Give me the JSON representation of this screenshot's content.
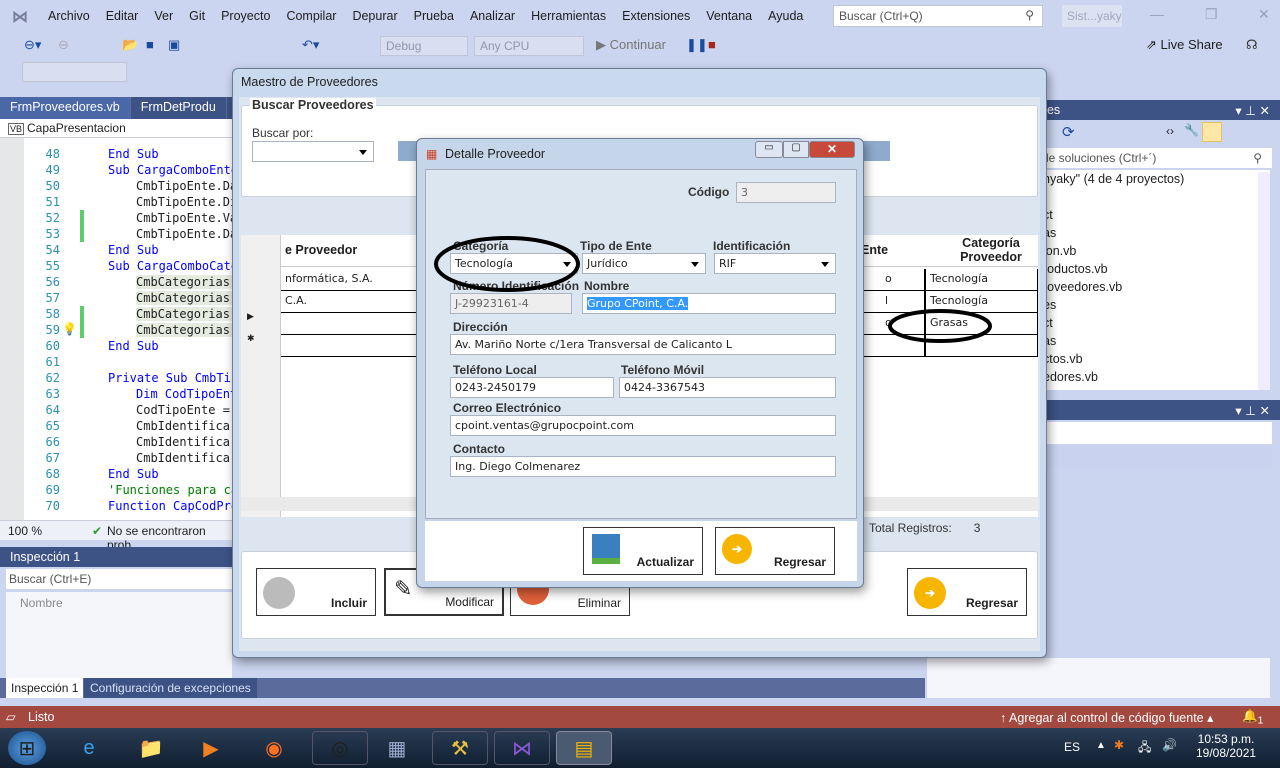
{
  "menu": [
    "Archivo",
    "Editar",
    "Ver",
    "Git",
    "Proyecto",
    "Compilar",
    "Depurar",
    "Prueba",
    "Analizar",
    "Herramientas",
    "Extensiones",
    "Ventana",
    "Ayuda"
  ],
  "search_placeholder": "Buscar (Ctrl+Q)",
  "solution_short": "Sist...yaky",
  "toolbar": {
    "config": "Debug",
    "platform": "Any CPU",
    "continue": "Continuar",
    "live_share": "Live Share"
  },
  "editor": {
    "tabs": [
      "FrmProveedores.vb",
      "FrmDetProdu"
    ],
    "project": "CapaPresentacion",
    "zoom": "100 %",
    "status": "No se encontraron prob",
    "lines": [
      {
        "n": "48",
        "t": "End Sub",
        "c": "kw",
        "i": 0
      },
      {
        "n": "49",
        "t": "Sub CargaComboEnte",
        "c": "kw",
        "i": 0
      },
      {
        "n": "50",
        "t": "CmbTipoEnte.Da",
        "c": "",
        "i": 1
      },
      {
        "n": "51",
        "t": "CmbTipoEnte.Di",
        "c": "",
        "i": 1
      },
      {
        "n": "52",
        "t": "CmbTipoEnte.Va",
        "c": "",
        "i": 1
      },
      {
        "n": "53",
        "t": "CmbTipoEnte.Da",
        "c": "",
        "i": 1
      },
      {
        "n": "54",
        "t": "End Sub",
        "c": "kw",
        "i": 0
      },
      {
        "n": "55",
        "t": "Sub CargaComboCate",
        "c": "kw",
        "i": 0
      },
      {
        "n": "56",
        "t": "CmbCategorias.",
        "c": "hl",
        "i": 1
      },
      {
        "n": "57",
        "t": "CmbCategorias.",
        "c": "hl",
        "i": 1
      },
      {
        "n": "58",
        "t": "CmbCategorias.",
        "c": "hl",
        "i": 1
      },
      {
        "n": "59",
        "t": "CmbCategorias.",
        "c": "hl",
        "i": 1
      },
      {
        "n": "60",
        "t": "End Sub",
        "c": "kw",
        "i": 0
      },
      {
        "n": "61",
        "t": "",
        "c": "",
        "i": 0
      },
      {
        "n": "62",
        "t": "Private Sub CmbTip",
        "c": "kw",
        "i": 0
      },
      {
        "n": "63",
        "t": "Dim CodTipoEnt",
        "c": "kw",
        "i": 1
      },
      {
        "n": "64",
        "t": "CodTipoEnte =",
        "c": "",
        "i": 1
      },
      {
        "n": "65",
        "t": "CmbIdentifica.",
        "c": "",
        "i": 1
      },
      {
        "n": "66",
        "t": "CmbIdentifica.",
        "c": "",
        "i": 1
      },
      {
        "n": "67",
        "t": "CmbIdentifica.",
        "c": "",
        "i": 1
      },
      {
        "n": "68",
        "t": "End Sub",
        "c": "kw",
        "i": 0
      },
      {
        "n": "69",
        "t": "'Funciones para ca",
        "c": "cm",
        "i": 0
      },
      {
        "n": "70",
        "t": "Function CapCodPro",
        "c": "kw",
        "i": 0
      }
    ]
  },
  "watch": {
    "title": "Inspección 1",
    "search": "Buscar (Ctrl+E)",
    "column": "Nombre",
    "tabs": [
      "Inspección 1",
      "Configuración de excepciones"
    ]
  },
  "solution_explorer": {
    "title": "nes",
    "search": "de soluciones (Ctrl+´)",
    "items": [
      "hyaky\" (4 de 4 proyectos)",
      "",
      "ct",
      "as",
      "ion.vb",
      "roductos.vb",
      "roveedores.vb",
      "es",
      "ct",
      "as",
      "ctos.vb",
      "edores.vb"
    ]
  },
  "maestro": {
    "title": "Maestro de Proveedores",
    "group": "Buscar Proveedores",
    "search_by_label": "Buscar por:",
    "col_name": "e Proveedor",
    "col_ente": "Ente",
    "col_cat": "Categoría Proveedor",
    "rows": [
      {
        "name": "nformática, S.A.",
        "ente": "o",
        "cat": "Tecnología"
      },
      {
        "name": "C.A.",
        "ente": "l",
        "cat": "Tecnología"
      },
      {
        "name": "",
        "ente": "o",
        "cat": "Grasas"
      },
      {
        "name": "",
        "ente": "",
        "cat": ""
      }
    ],
    "total_label": "Total Registros:",
    "total": "3",
    "buttons": {
      "incluir": "Incluir",
      "modificar": "Modificar",
      "eliminar": "Eliminar",
      "regresar": "Regresar"
    }
  },
  "detalle": {
    "title": "Detalle Proveedor",
    "codigo_label": "Código",
    "codigo": "3",
    "categoria_label": "Categoría",
    "categoria": "Tecnología",
    "tipo_label": "Tipo de Ente",
    "tipo": "Jurídico",
    "ident_label": "Identificación",
    "ident": "RIF",
    "numero_label": "Número Identificación",
    "numero": "J-29923161-4",
    "nombre_label": "Nombre",
    "nombre": "Grupo CPoint, C.A.",
    "direccion_label": "Dirección",
    "direccion": "Av. Mariño Norte c/1era Transversal de Calicanto L",
    "tel_local_label": "Teléfono Local",
    "tel_local": "0243-2450179",
    "tel_movil_label": "Teléfono Móvil",
    "tel_movil": "0424-3367543",
    "correo_label": "Correo Electrónico",
    "correo": "cpoint.ventas@grupocpoint.com",
    "contacto_label": "Contacto",
    "contacto": "Ing. Diego Colmenarez",
    "actualizar": "Actualizar",
    "regresar": "Regresar"
  },
  "statusbar": {
    "ready": "Listo",
    "source_control": "Agregar al control de código fuente",
    "notifications": "1"
  },
  "taskbar": {
    "lang": "ES",
    "time": "10:53 p.m.",
    "date": "19/08/2021"
  },
  "colors": {
    "statusbar": "#a4493f",
    "vs_bg": "#ccd5f0",
    "panel_header": "#3d5285",
    "selection": "#3399ff"
  }
}
